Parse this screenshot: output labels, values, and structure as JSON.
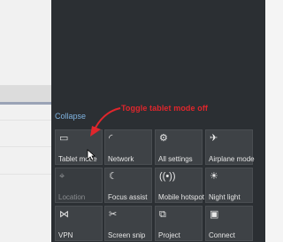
{
  "callout": {
    "text": "Toggle tablet mode off",
    "color": "#e0262c"
  },
  "panel": {
    "collapse_label": "Collapse",
    "tiles": [
      {
        "label": "Tablet mode",
        "icon": "tablet-icon",
        "state": "on"
      },
      {
        "label": "Network",
        "icon": "network-icon",
        "state": "normal"
      },
      {
        "label": "All settings",
        "icon": "gear-icon",
        "state": "normal"
      },
      {
        "label": "Airplane mode",
        "icon": "airplane-icon",
        "state": "normal"
      },
      {
        "label": "Location",
        "icon": "location-icon",
        "state": "disabled"
      },
      {
        "label": "Focus assist",
        "icon": "moon-icon",
        "state": "normal"
      },
      {
        "label": "Mobile hotspot",
        "icon": "hotspot-icon",
        "state": "normal"
      },
      {
        "label": "Night light",
        "icon": "sun-icon",
        "state": "normal"
      },
      {
        "label": "VPN",
        "icon": "vpn-icon",
        "state": "normal"
      },
      {
        "label": "Screen snip",
        "icon": "scissors-icon",
        "state": "normal"
      },
      {
        "label": "Project",
        "icon": "project-icon",
        "state": "normal"
      },
      {
        "label": "Connect",
        "icon": "connect-icon",
        "state": "normal"
      }
    ]
  }
}
